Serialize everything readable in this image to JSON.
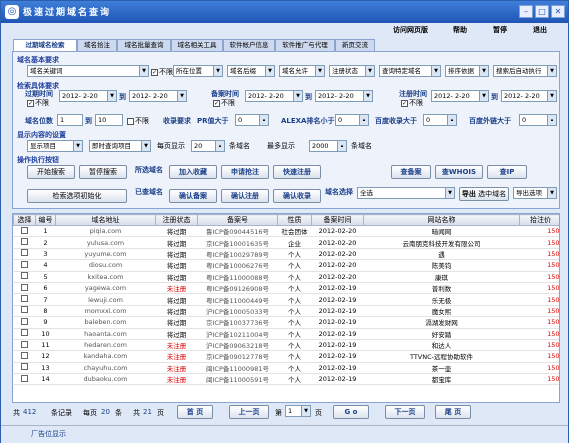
{
  "window": {
    "title": "极速过期域名查询",
    "icon": "globe-icon"
  },
  "menu": [
    "访问网页版",
    "帮助",
    "暂停",
    "退出"
  ],
  "tabs": [
    "过期域名检索",
    "域名拾注",
    "域名批量查询",
    "域名相关工具",
    "软件帐户信息",
    "软件推广与代理",
    "新页交流"
  ],
  "basic": {
    "heading": "域名基本要求",
    "keyword_label": "域名关键词",
    "keyword_option": "域名关键词",
    "nolimit": "不限",
    "position": "所在位置",
    "suffix": "域名后缀",
    "allow": "域名允许",
    "reg_status": "注册状态",
    "query_domain": "查询特定域名",
    "sort_by": "排序依据",
    "auto_exec": "搜索后自动执行"
  },
  "specific": {
    "heading": "检索具体要求",
    "expire_label": "过期时间",
    "record_label": "备案时间",
    "reg_label": "注册时间",
    "date_from": "2012- 2-20",
    "to": "到",
    "date_to": "2012- 2-20",
    "nolimit": "不限",
    "digits_label": "域名位数",
    "digits_from": "1",
    "digits_to": "10",
    "include_label": "收录要求",
    "pr_label": "PR值大于",
    "pr_val": "0",
    "alexa_label": "ALEXA排名小于",
    "alexa_val": "0",
    "baidu_include_label": "百度收录大于",
    "baidu_include_val": "0",
    "baidu_ext_label": "百度外链大于",
    "baidu_ext_val": "0"
  },
  "display": {
    "heading": "显示内容的设置",
    "item": "显示项目",
    "instant": "即时查询项目",
    "per_page_label": "每页显示",
    "per_page_val": "20",
    "per_page_unit": "条域名",
    "max_label": "最多显示",
    "max_val": "2000",
    "max_unit": "条域名"
  },
  "ops": {
    "heading": "操作执行按钮",
    "start_search": "开始搜索",
    "pause_search": "暂停搜索",
    "selected_label": "所选域名",
    "add_fav": "加入收藏",
    "apply_pick": "申请抢注",
    "quick_reg": "快速注册",
    "check_record": "查备案",
    "check_whois": "查WHOIS",
    "check_ip": "查IP",
    "init_search": "检索选项初始化",
    "selected_label2": "已查域名",
    "confirm_record": "确认备案",
    "confirm_reg": "确认注册",
    "confirm_include": "确认收录",
    "domain_select_label": "域名选择",
    "select_all": "全选",
    "export_selected": "导出",
    "export_selected_tail": "选中域名",
    "export_options": "导出选项"
  },
  "table": {
    "columns": [
      "选择",
      "编号",
      "域名地址",
      "注册状态",
      "备案号",
      "性质",
      "备案时间",
      "网站名称",
      "拾注价"
    ],
    "rows": [
      [
        "1",
        "piqia.com",
        "将过期",
        "鲁ICP备09044516号",
        "社会团体",
        "2012-02-20",
        "暗闻网",
        "150"
      ],
      [
        "2",
        "yulusa.com",
        "将过期",
        "京ICP备10001635号",
        "企业",
        "2012-02-20",
        "云南朋克科技开发有限公司",
        "150"
      ],
      [
        "3",
        "yuyume.com",
        "将过期",
        "粤ICP备10029789号",
        "个人",
        "2012-02-20",
        "遇",
        "150"
      ],
      [
        "4",
        "diosu.com",
        "将过期",
        "粤ICP备10006276号",
        "个人",
        "2012-02-20",
        "陈美钧",
        "150"
      ],
      [
        "5",
        "kxitea.com",
        "将过期",
        "粤ICP备11000088号",
        "个人",
        "2012-02-20",
        "康琪",
        "150"
      ],
      [
        "6",
        "yagewa.com",
        "未注册",
        "粤ICP备09126908号",
        "个人",
        "2012-02-19",
        "普利数",
        "150"
      ],
      [
        "7",
        "lewuji.com",
        "将过期",
        "粤ICP备11000449号",
        "个人",
        "2012-02-19",
        "乐无极",
        "150"
      ],
      [
        "8",
        "momxxi.com",
        "将过期",
        "沪ICP备10005033号",
        "个人",
        "2012-02-19",
        "魔女熙",
        "150"
      ],
      [
        "9",
        "baleben.com",
        "将过期",
        "京ICP备10037736号",
        "个人",
        "2012-02-19",
        "滆湖发财网",
        "150"
      ],
      [
        "10",
        "haoanta.com",
        "将过期",
        "沪ICP备10211004号",
        "个人",
        "2012-02-19",
        "好安踏",
        "150"
      ],
      [
        "11",
        "hedaren.com",
        "未注册",
        "沪ICP备09063218号",
        "个人",
        "2012-02-19",
        "和达人",
        "150"
      ],
      [
        "12",
        "kandaha.com",
        "未注册",
        "京ICP备09012778号",
        "个人",
        "2012-02-19",
        "TTVNC-远程协助软件",
        "150"
      ],
      [
        "13",
        "chayuhu.com",
        "未注册",
        "闽ICP备11000981号",
        "个人",
        "2012-02-19",
        "茶一壶",
        "150"
      ],
      [
        "14",
        "dubaoku.com",
        "未注册",
        "闽ICP备11000591号",
        "个人",
        "2012-02-19",
        "都宝库",
        "150"
      ]
    ]
  },
  "pager": {
    "total_prefix": "共",
    "total": "412",
    "total_unit": "条记录",
    "per_prefix": "每页",
    "per": "20",
    "per_unit": "条",
    "pages_prefix": "共",
    "pages": "21",
    "pages_unit": "页",
    "first": "首 页",
    "prev": "上一页",
    "page_prefix": "第",
    "page_val": "1",
    "page_unit": "页",
    "go": "G o",
    "next": "下一页",
    "last": "尾 页"
  },
  "status": "厂告位显示"
}
